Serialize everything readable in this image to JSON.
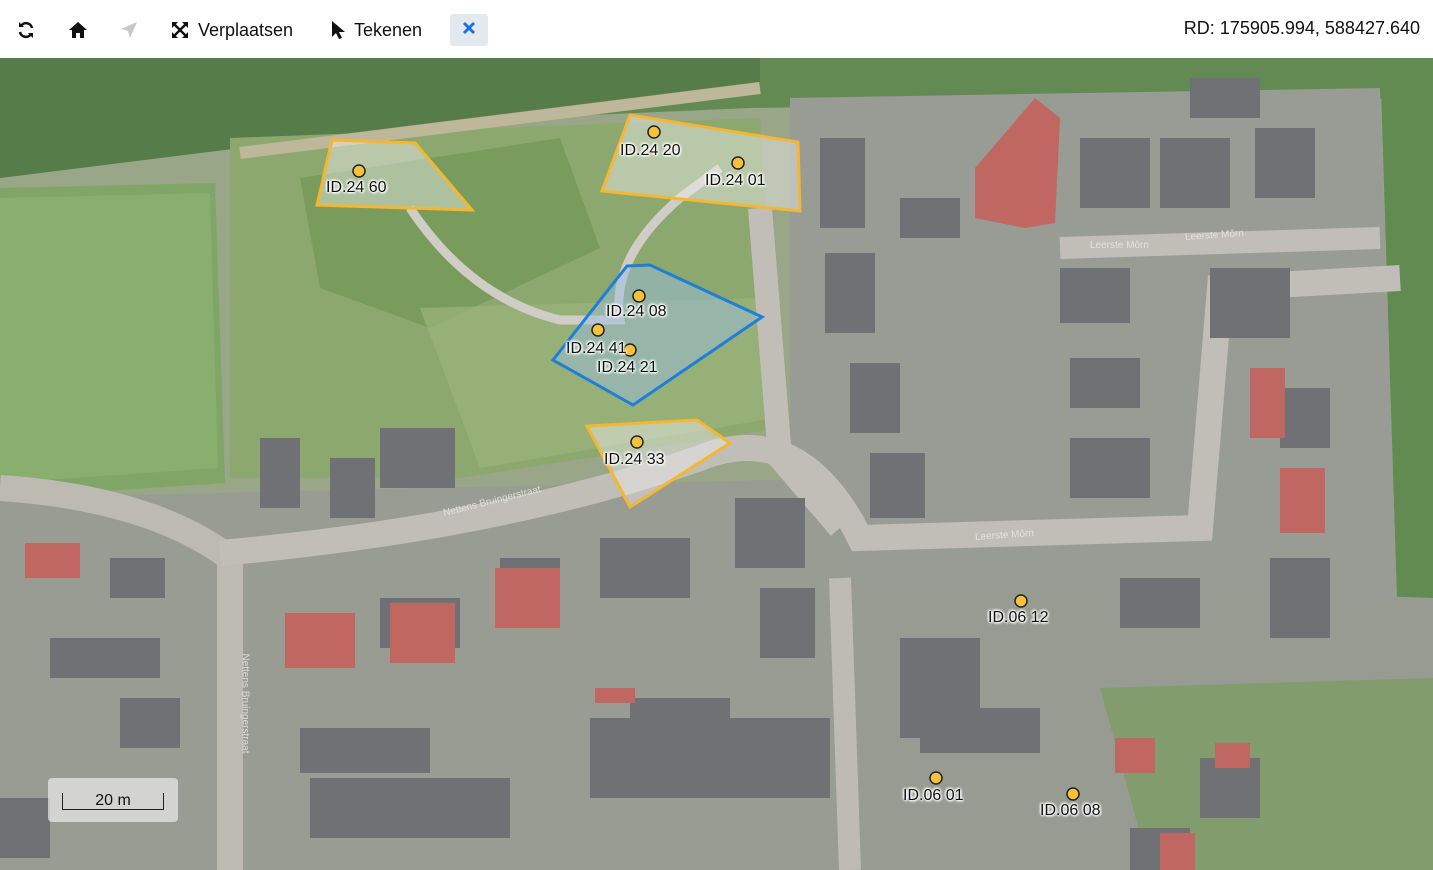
{
  "toolbar": {
    "refresh_icon": "refresh-icon",
    "home_icon": "home-icon",
    "locate_icon": "location-arrow-icon",
    "move_label": "Verplaatsen",
    "move_icon": "expand-arrows-icon",
    "draw_label": "Tekenen",
    "draw_icon": "pointer-icon",
    "clear_icon": "close-icon"
  },
  "coordinates": "RD: 175905.994, 588427.640",
  "colors": {
    "accent": "#1a73d9",
    "parcel_outline": "#f5b731",
    "selected_outline": "#1e7fd6",
    "marker_fill": "#f7c23b"
  },
  "parcels": [
    {
      "id": "ID.24 60",
      "selected": false
    },
    {
      "id": "ID.24 20",
      "selected": false
    },
    {
      "id": "ID.24 01",
      "selected": false
    },
    {
      "id": "ID.24 08",
      "selected": true
    },
    {
      "id": "ID.24 41",
      "selected": true
    },
    {
      "id": "ID.24 21",
      "selected": true
    },
    {
      "id": "ID.24 33",
      "selected": false
    },
    {
      "id": "ID.06 12",
      "selected": false
    },
    {
      "id": "ID.06 01",
      "selected": false
    },
    {
      "id": "ID.06 08",
      "selected": false
    }
  ],
  "streets": [
    "Nettens Bruingerstraat",
    "Leerste Môrn",
    "Leerste Môrn",
    "Nettens Bruingerstraat",
    "Leerste Môrn"
  ],
  "scale": "20 m"
}
